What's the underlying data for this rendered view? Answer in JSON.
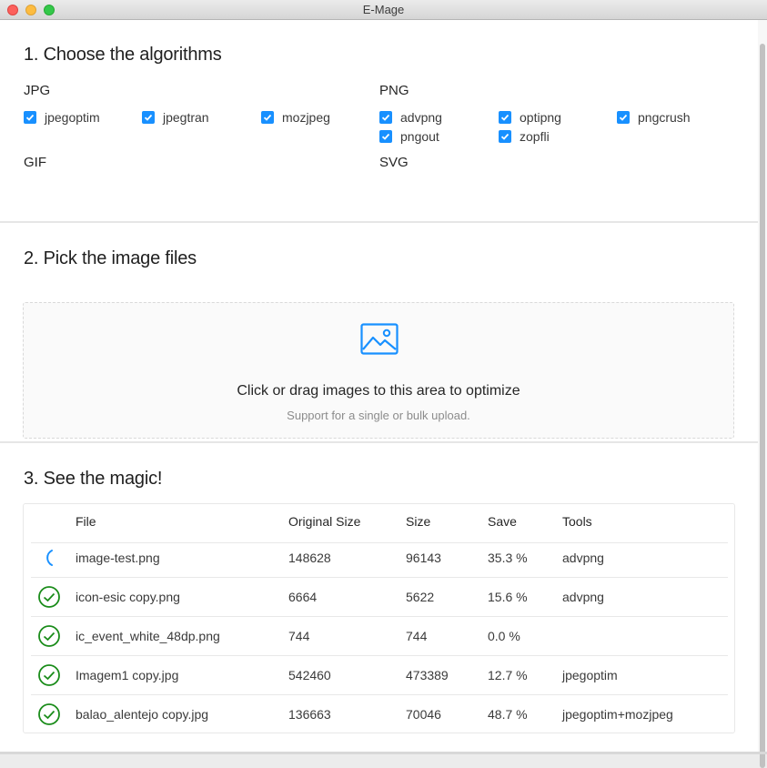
{
  "window": {
    "title": "E-Mage"
  },
  "algorithms": {
    "heading": "1. Choose the algorithms",
    "jpg": {
      "label": "JPG",
      "options": [
        {
          "label": "jpegoptim",
          "checked": true
        },
        {
          "label": "jpegtran",
          "checked": true
        },
        {
          "label": "mozjpeg",
          "checked": true
        }
      ]
    },
    "png": {
      "label": "PNG",
      "options": [
        {
          "label": "advpng",
          "checked": true
        },
        {
          "label": "optipng",
          "checked": true
        },
        {
          "label": "pngcrush",
          "checked": true
        },
        {
          "label": "pngout",
          "checked": true
        },
        {
          "label": "zopfli",
          "checked": true
        }
      ]
    },
    "gif": {
      "label": "GIF",
      "options": []
    },
    "svg": {
      "label": "SVG",
      "options": []
    }
  },
  "upload": {
    "heading": "2. Pick the image files",
    "text": "Click or drag images to this area to optimize",
    "hint": "Support for a single or bulk upload.",
    "icon": "picture-icon"
  },
  "results": {
    "heading": "3. See the magic!",
    "columns": [
      "File",
      "Original Size",
      "Size",
      "Save",
      "Tools"
    ],
    "rows": [
      {
        "status": "loading",
        "file": "image-test.png",
        "original": "148628",
        "size": "96143",
        "save": "35.3 %",
        "tools": "advpng"
      },
      {
        "status": "done",
        "file": "icon-esic copy.png",
        "original": "6664",
        "size": "5622",
        "save": "15.6 %",
        "tools": "advpng"
      },
      {
        "status": "done",
        "file": "ic_event_white_48dp.png",
        "original": "744",
        "size": "744",
        "save": "0.0 %",
        "tools": ""
      },
      {
        "status": "done",
        "file": "Imagem1 copy.jpg",
        "original": "542460",
        "size": "473389",
        "save": "12.7 %",
        "tools": "jpegoptim"
      },
      {
        "status": "done",
        "file": "balao_alentejo copy.jpg",
        "original": "136663",
        "size": "70046",
        "save": "48.7 %",
        "tools": "jpegoptim+mozjpeg"
      }
    ]
  },
  "colors": {
    "accent": "#1890ff",
    "success": "#1a8c1a"
  }
}
